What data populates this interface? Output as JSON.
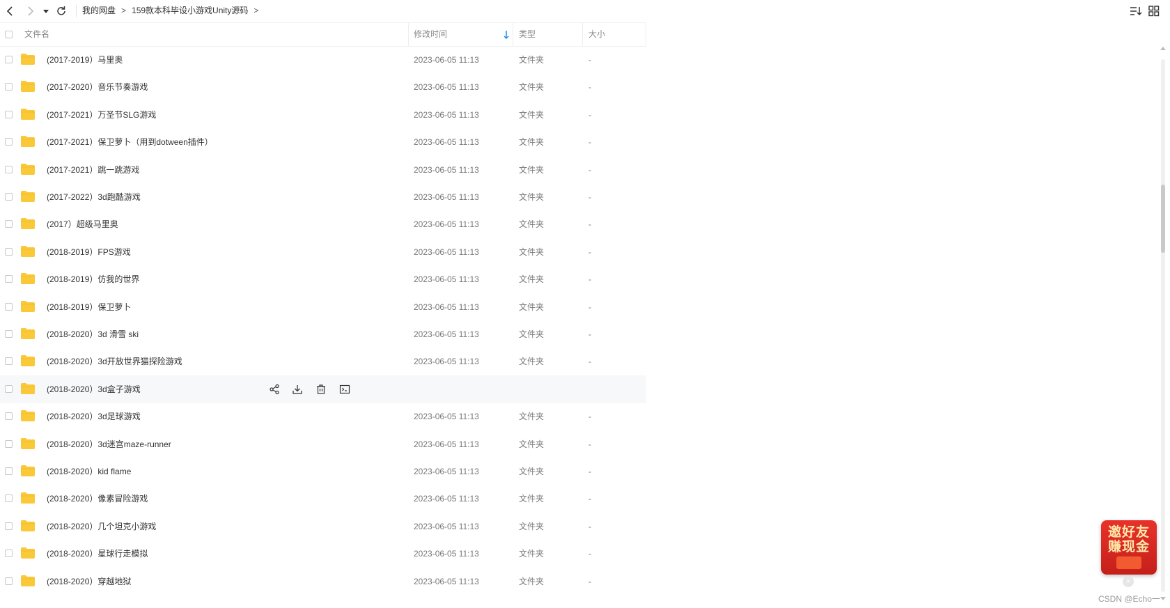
{
  "toolbar": {
    "back_icon": "chevron-left-icon",
    "forward_icon": "chevron-right-icon",
    "history_icon": "caret-down-icon",
    "refresh_icon": "refresh-icon",
    "sort_icon": "sort-list-icon",
    "grid_icon": "grid-view-icon"
  },
  "breadcrumb": {
    "items": [
      "我的网盘",
      "159款本科毕设小游戏Unity源码"
    ],
    "separator": ">"
  },
  "header": {
    "name": "文件名",
    "modified": "修改时间",
    "type": "类型",
    "size": "大小",
    "sort_color": "#1a8cff"
  },
  "files": [
    {
      "name": "(2017-2019）马里奥",
      "date": "2023-06-05 11:13",
      "type": "文件夹",
      "size": "-"
    },
    {
      "name": "(2017-2020）音乐节奏游戏",
      "date": "2023-06-05 11:13",
      "type": "文件夹",
      "size": "-"
    },
    {
      "name": "(2017-2021）万圣节SLG游戏",
      "date": "2023-06-05 11:13",
      "type": "文件夹",
      "size": "-"
    },
    {
      "name": "(2017-2021）保卫萝卜（用到dotween插件）",
      "date": "2023-06-05 11:13",
      "type": "文件夹",
      "size": "-"
    },
    {
      "name": "(2017-2021）跳一跳游戏",
      "date": "2023-06-05 11:13",
      "type": "文件夹",
      "size": "-"
    },
    {
      "name": "(2017-2022）3d跑酷游戏",
      "date": "2023-06-05 11:13",
      "type": "文件夹",
      "size": "-"
    },
    {
      "name": "(2017）超级马里奥",
      "date": "2023-06-05 11:13",
      "type": "文件夹",
      "size": "-"
    },
    {
      "name": "(2018-2019）FPS游戏",
      "date": "2023-06-05 11:13",
      "type": "文件夹",
      "size": "-"
    },
    {
      "name": "(2018-2019）仿我的世界",
      "date": "2023-06-05 11:13",
      "type": "文件夹",
      "size": "-"
    },
    {
      "name": "(2018-2019）保卫萝卜",
      "date": "2023-06-05 11:13",
      "type": "文件夹",
      "size": "-"
    },
    {
      "name": "(2018-2020）3d 滑雪 ski",
      "date": "2023-06-05 11:13",
      "type": "文件夹",
      "size": "-"
    },
    {
      "name": "(2018-2020）3d开放世界猫探险游戏",
      "date": "2023-06-05 11:13",
      "type": "文件夹",
      "size": "-"
    },
    {
      "name": "(2018-2020）3d盒子游戏",
      "date": "",
      "type": "",
      "size": "",
      "hover": true
    },
    {
      "name": "(2018-2020）3d足球游戏",
      "date": "2023-06-05 11:13",
      "type": "文件夹",
      "size": "-"
    },
    {
      "name": "(2018-2020）3d迷宫maze-runner",
      "date": "2023-06-05 11:13",
      "type": "文件夹",
      "size": "-"
    },
    {
      "name": "(2018-2020）kid flame",
      "date": "2023-06-05 11:13",
      "type": "文件夹",
      "size": "-"
    },
    {
      "name": "(2018-2020）像素冒险游戏",
      "date": "2023-06-05 11:13",
      "type": "文件夹",
      "size": "-"
    },
    {
      "name": "(2018-2020）几个坦克小游戏",
      "date": "2023-06-05 11:13",
      "type": "文件夹",
      "size": "-"
    },
    {
      "name": "(2018-2020）星球行走模拟",
      "date": "2023-06-05 11:13",
      "type": "文件夹",
      "size": "-"
    },
    {
      "name": "(2018-2020）穿越地狱",
      "date": "2023-06-05 11:13",
      "type": "文件夹",
      "size": "-"
    }
  ],
  "row_actions": [
    "share-icon",
    "download-icon",
    "delete-icon",
    "rename-icon"
  ],
  "folder_color": "#f9c939",
  "promo": {
    "line1": "邀好友",
    "line2": "赚现金",
    "close": "×"
  },
  "watermark": "CSDN @Echo一"
}
